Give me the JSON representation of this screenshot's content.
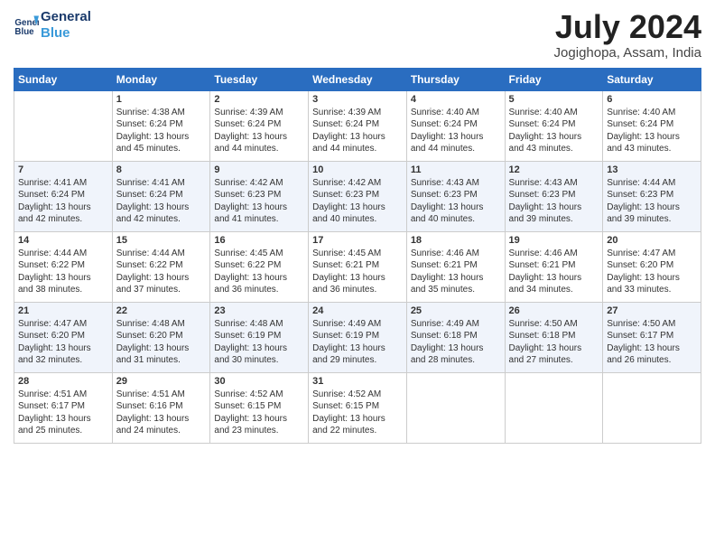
{
  "logo": {
    "line1": "General",
    "line2": "Blue"
  },
  "title": "July 2024",
  "location": "Jogighopa, Assam, India",
  "headers": [
    "Sunday",
    "Monday",
    "Tuesday",
    "Wednesday",
    "Thursday",
    "Friday",
    "Saturday"
  ],
  "weeks": [
    [
      {
        "day": "",
        "content": ""
      },
      {
        "day": "1",
        "content": "Sunrise: 4:38 AM\nSunset: 6:24 PM\nDaylight: 13 hours\nand 45 minutes."
      },
      {
        "day": "2",
        "content": "Sunrise: 4:39 AM\nSunset: 6:24 PM\nDaylight: 13 hours\nand 44 minutes."
      },
      {
        "day": "3",
        "content": "Sunrise: 4:39 AM\nSunset: 6:24 PM\nDaylight: 13 hours\nand 44 minutes."
      },
      {
        "day": "4",
        "content": "Sunrise: 4:40 AM\nSunset: 6:24 PM\nDaylight: 13 hours\nand 44 minutes."
      },
      {
        "day": "5",
        "content": "Sunrise: 4:40 AM\nSunset: 6:24 PM\nDaylight: 13 hours\nand 43 minutes."
      },
      {
        "day": "6",
        "content": "Sunrise: 4:40 AM\nSunset: 6:24 PM\nDaylight: 13 hours\nand 43 minutes."
      }
    ],
    [
      {
        "day": "7",
        "content": "Sunrise: 4:41 AM\nSunset: 6:24 PM\nDaylight: 13 hours\nand 42 minutes."
      },
      {
        "day": "8",
        "content": "Sunrise: 4:41 AM\nSunset: 6:24 PM\nDaylight: 13 hours\nand 42 minutes."
      },
      {
        "day": "9",
        "content": "Sunrise: 4:42 AM\nSunset: 6:23 PM\nDaylight: 13 hours\nand 41 minutes."
      },
      {
        "day": "10",
        "content": "Sunrise: 4:42 AM\nSunset: 6:23 PM\nDaylight: 13 hours\nand 40 minutes."
      },
      {
        "day": "11",
        "content": "Sunrise: 4:43 AM\nSunset: 6:23 PM\nDaylight: 13 hours\nand 40 minutes."
      },
      {
        "day": "12",
        "content": "Sunrise: 4:43 AM\nSunset: 6:23 PM\nDaylight: 13 hours\nand 39 minutes."
      },
      {
        "day": "13",
        "content": "Sunrise: 4:44 AM\nSunset: 6:23 PM\nDaylight: 13 hours\nand 39 minutes."
      }
    ],
    [
      {
        "day": "14",
        "content": "Sunrise: 4:44 AM\nSunset: 6:22 PM\nDaylight: 13 hours\nand 38 minutes."
      },
      {
        "day": "15",
        "content": "Sunrise: 4:44 AM\nSunset: 6:22 PM\nDaylight: 13 hours\nand 37 minutes."
      },
      {
        "day": "16",
        "content": "Sunrise: 4:45 AM\nSunset: 6:22 PM\nDaylight: 13 hours\nand 36 minutes."
      },
      {
        "day": "17",
        "content": "Sunrise: 4:45 AM\nSunset: 6:21 PM\nDaylight: 13 hours\nand 36 minutes."
      },
      {
        "day": "18",
        "content": "Sunrise: 4:46 AM\nSunset: 6:21 PM\nDaylight: 13 hours\nand 35 minutes."
      },
      {
        "day": "19",
        "content": "Sunrise: 4:46 AM\nSunset: 6:21 PM\nDaylight: 13 hours\nand 34 minutes."
      },
      {
        "day": "20",
        "content": "Sunrise: 4:47 AM\nSunset: 6:20 PM\nDaylight: 13 hours\nand 33 minutes."
      }
    ],
    [
      {
        "day": "21",
        "content": "Sunrise: 4:47 AM\nSunset: 6:20 PM\nDaylight: 13 hours\nand 32 minutes."
      },
      {
        "day": "22",
        "content": "Sunrise: 4:48 AM\nSunset: 6:20 PM\nDaylight: 13 hours\nand 31 minutes."
      },
      {
        "day": "23",
        "content": "Sunrise: 4:48 AM\nSunset: 6:19 PM\nDaylight: 13 hours\nand 30 minutes."
      },
      {
        "day": "24",
        "content": "Sunrise: 4:49 AM\nSunset: 6:19 PM\nDaylight: 13 hours\nand 29 minutes."
      },
      {
        "day": "25",
        "content": "Sunrise: 4:49 AM\nSunset: 6:18 PM\nDaylight: 13 hours\nand 28 minutes."
      },
      {
        "day": "26",
        "content": "Sunrise: 4:50 AM\nSunset: 6:18 PM\nDaylight: 13 hours\nand 27 minutes."
      },
      {
        "day": "27",
        "content": "Sunrise: 4:50 AM\nSunset: 6:17 PM\nDaylight: 13 hours\nand 26 minutes."
      }
    ],
    [
      {
        "day": "28",
        "content": "Sunrise: 4:51 AM\nSunset: 6:17 PM\nDaylight: 13 hours\nand 25 minutes."
      },
      {
        "day": "29",
        "content": "Sunrise: 4:51 AM\nSunset: 6:16 PM\nDaylight: 13 hours\nand 24 minutes."
      },
      {
        "day": "30",
        "content": "Sunrise: 4:52 AM\nSunset: 6:15 PM\nDaylight: 13 hours\nand 23 minutes."
      },
      {
        "day": "31",
        "content": "Sunrise: 4:52 AM\nSunset: 6:15 PM\nDaylight: 13 hours\nand 22 minutes."
      },
      {
        "day": "",
        "content": ""
      },
      {
        "day": "",
        "content": ""
      },
      {
        "day": "",
        "content": ""
      }
    ]
  ]
}
